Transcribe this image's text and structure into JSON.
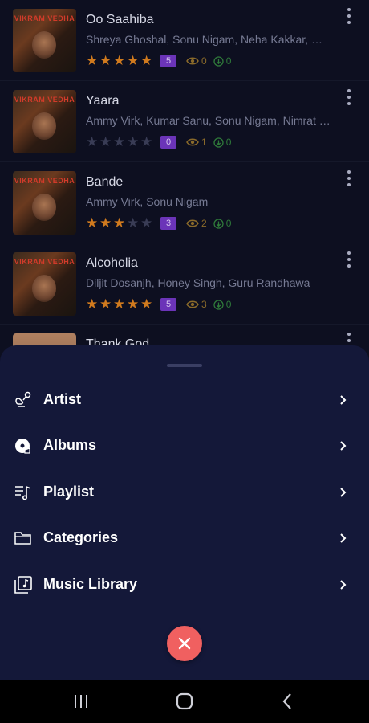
{
  "songs": [
    {
      "title": "Oo Saahiba",
      "artists": "Shreya Ghoshal, Sonu Nigam, Neha Kakkar, Mika Singh",
      "rating": 5,
      "badge": "5",
      "views": "0",
      "downloads": "0",
      "poster_text": "VIKRAM VEDHA"
    },
    {
      "title": "Yaara",
      "artists": "Ammy Virk, Kumar Sanu, Sonu Nigam, Nimrat Khaira",
      "rating": 0,
      "badge": "0",
      "views": "1",
      "downloads": "0",
      "poster_text": "VIKRAM VEDHA"
    },
    {
      "title": "Bande",
      "artists": "Ammy Virk, Sonu Nigam",
      "rating": 3,
      "badge": "3",
      "views": "2",
      "downloads": "0",
      "poster_text": "VIKRAM VEDHA"
    },
    {
      "title": "Alcoholia",
      "artists": "Diljit Dosanjh, Honey Singh, Guru Randhawa",
      "rating": 5,
      "badge": "5",
      "views": "3",
      "downloads": "0",
      "poster_text": "VIKRAM VEDHA"
    },
    {
      "title": "Thank God"
    }
  ],
  "menu": [
    {
      "label": "Artist",
      "icon": "artist-icon"
    },
    {
      "label": "Albums",
      "icon": "album-disc-icon"
    },
    {
      "label": "Playlist",
      "icon": "playlist-icon"
    },
    {
      "label": "Categories",
      "icon": "folder-icon"
    },
    {
      "label": "Music Library",
      "icon": "music-library-icon"
    }
  ],
  "colors": {
    "sheet_bg": "#141839",
    "star_active": "#d07a1e",
    "badge_bg": "#6b34b8",
    "close_bg": "#f06060"
  },
  "system_nav": {
    "icons": [
      "recent-apps-icon",
      "home-icon",
      "back-icon"
    ]
  }
}
